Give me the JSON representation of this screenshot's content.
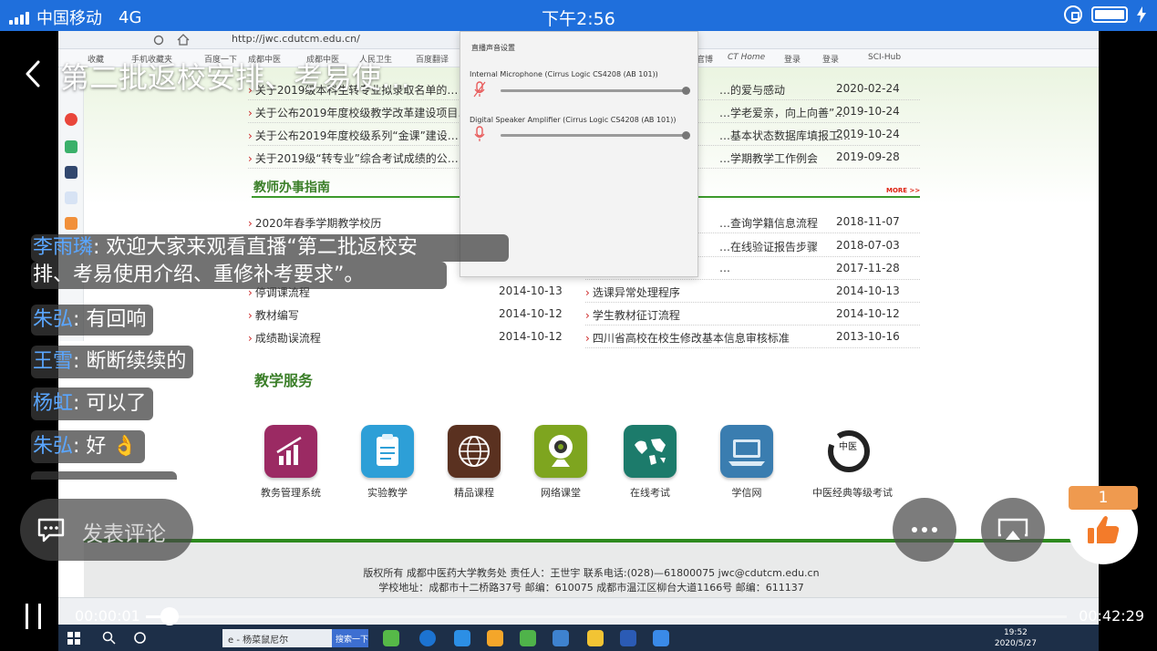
{
  "status_bar": {
    "carrier": "中国移动",
    "network": "4G",
    "time": "下午2:56"
  },
  "stream": {
    "title": "第二批返校安排、考易使…"
  },
  "browser": {
    "url": "http://jwc.cdutcm.edu.cn/",
    "bookmarks": [
      "收藏",
      "手机收藏夹",
      "百度一下",
      "成都中医",
      "成都中医",
      "人民卫生",
      "百度翻译",
      "官博",
      "CT Home",
      "登录",
      "登录",
      "SCI-Hub"
    ]
  },
  "sound_popup": {
    "title": "直播声音设置",
    "input_device": "Internal Microphone (Cirrus Logic CS4208 (AB 101))",
    "output_device": "Digital Speaker Amplifier (Cirrus Logic CS4208 (AB 101))",
    "input_level": 1.0,
    "output_level": 1.0
  },
  "news_rows": [
    {
      "title": "关于2019级本科生转专业拟录取名单的…",
      "date": "2020-02-24"
    },
    {
      "title": "关于公布2019年度校级教学改革建设项目…",
      "date": "2019-10-24"
    },
    {
      "title": "关于公布2019年度校级系列“金课”建设…",
      "date": "2019-10-24"
    },
    {
      "title": "关于2019级“转专业”综合考试成绩的公…",
      "date": "2019-09-28"
    }
  ],
  "news_right": [
    {
      "title": "…的爱与感动",
      "date": "2020-02-24"
    },
    {
      "title": "…学老爱亲，向上向善”…",
      "date": "2019-10-24"
    },
    {
      "title": "…基本状态数据库填报工…",
      "date": "2019-10-24"
    },
    {
      "title": "…学期教学工作例会",
      "date": "2019-09-28"
    }
  ],
  "guide_section": {
    "title": "教师办事指南",
    "more": "MORE >>"
  },
  "guide_left": [
    {
      "title": "2020年春季学期教学校历",
      "date": ""
    },
    {
      "title": "停调课流程",
      "date": "2014-10-13"
    },
    {
      "title": "教材编写",
      "date": "2014-10-12"
    },
    {
      "title": "成绩勘误流程",
      "date": "2014-10-12"
    }
  ],
  "guide_right": [
    {
      "title": "…查询学籍信息流程",
      "date": "2018-11-07"
    },
    {
      "title": "…在线验证报告步骤",
      "date": "2018-07-03"
    },
    {
      "title": "…",
      "date": "2017-11-28"
    },
    {
      "title": "选课异常处理程序",
      "date": "2014-10-13"
    },
    {
      "title": "学生教材征订流程",
      "date": "2014-10-12"
    },
    {
      "title": "四川省高校在校生修改基本信息审核标准",
      "date": "2013-10-16"
    }
  ],
  "services": {
    "title": "教学服务",
    "items": [
      {
        "label": "教务管理系统",
        "icon": "chart-icon",
        "color": "#9b2a63"
      },
      {
        "label": "实验教学",
        "icon": "clipboard-icon",
        "color": "#2d9fd7"
      },
      {
        "label": "精品课程",
        "icon": "globe-icon",
        "color": "#5a3120"
      },
      {
        "label": "网络课堂",
        "icon": "webcam-icon",
        "color": "#7ea51f"
      },
      {
        "label": "在线考试",
        "icon": "world-map-icon",
        "color": "#1c7b6b"
      },
      {
        "label": "学信网",
        "icon": "laptop-icon",
        "color": "#3a7db0"
      },
      {
        "label": "中医经典等级考试",
        "icon": "calligraphy-seal-icon",
        "color": "#222222"
      }
    ]
  },
  "footer": {
    "line1": "版权所有 成都中医药大学教务处 责任人：王世宇 联系电话:(028)—61800075 jwc@cdutcm.edu.cn",
    "line2": "学校地址：成都市十二桥路37号 邮编：610075 成都市温江区柳台大道1166号 邮编：611137"
  },
  "taskbar": {
    "search_text": "e - 杨菜鼠尼尔",
    "search_button": "搜索一下",
    "clock_time": "19:52",
    "clock_date": "2020/5/27"
  },
  "chat": [
    {
      "nick": "李雨璘",
      "msg": "欢迎大家来观看直播“第二批返校安",
      "msg2": "排、考易使用介绍、重修补考要求”。"
    },
    {
      "nick": "朱弘",
      "msg": "有回响"
    },
    {
      "nick": "王雪",
      "msg": "断断续续的"
    },
    {
      "nick": "杨虹",
      "msg": "可以了"
    },
    {
      "nick": "朱弘",
      "msg": "好 👌"
    }
  ],
  "comment": {
    "placeholder": "发表评论"
  },
  "like_count": "1",
  "player": {
    "current_time": "00:00:01",
    "total_time": "00:42:29",
    "progress": 0.0004
  },
  "colors": {
    "status_bar": "#1f6fdc",
    "nick": "#5aa6ff",
    "like_badge": "#ef9a4f",
    "site_green": "#3b7f29"
  }
}
